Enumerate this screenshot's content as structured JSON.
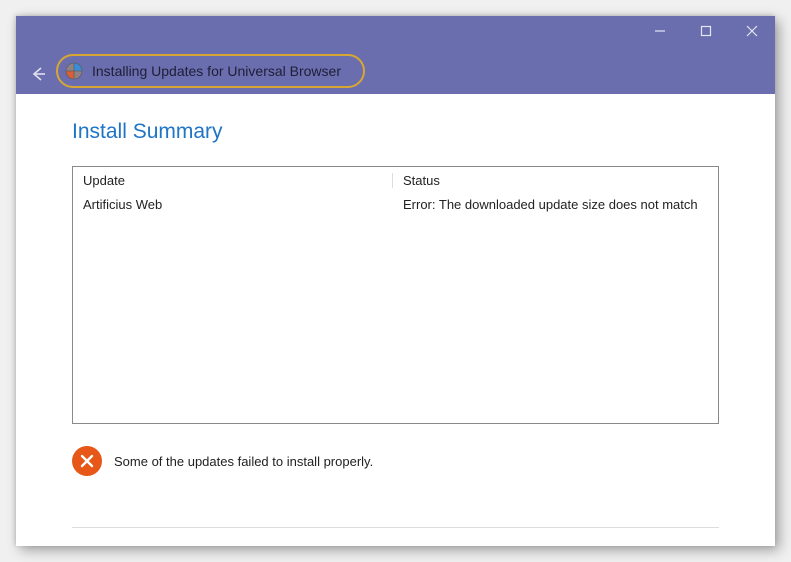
{
  "window": {
    "title": "Installing Updates for Universal Browser"
  },
  "heading": "Install Summary",
  "table": {
    "headers": {
      "update": "Update",
      "status": "Status"
    },
    "rows": [
      {
        "update": "Artificius Web",
        "status": "Error: The downloaded update size does not match"
      }
    ]
  },
  "footer": {
    "message": "Some of the updates failed to install properly."
  }
}
